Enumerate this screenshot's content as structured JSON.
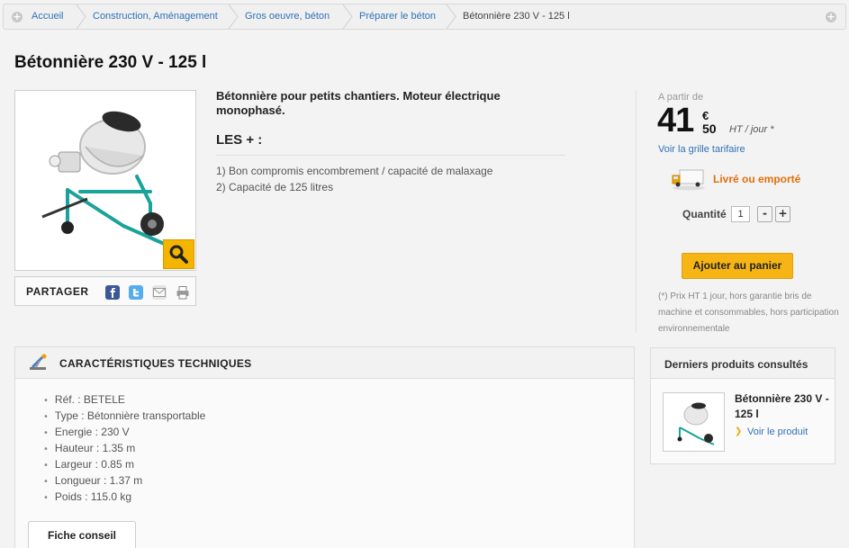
{
  "breadcrumb": {
    "items": [
      "Accueil",
      "Construction, Aménagement",
      "Gros oeuvre, béton",
      "Préparer le béton",
      "Bétonnière 230 V - 125 l"
    ],
    "plus_glyph": "+"
  },
  "product": {
    "title": "Bétonnière 230 V - 125 l",
    "description": "Bétonnière pour petits chantiers. Moteur électrique monophasé.",
    "plus_title": "LES + :",
    "plus_items": [
      "1) Bon compromis encombrement / capacité de malaxage",
      "2) Capacité de 125 litres"
    ],
    "share_label": "PARTAGER"
  },
  "pricing": {
    "from_label": "A partir de",
    "price_int": "41",
    "currency": "€",
    "price_dec": "50",
    "unit": "HT / jour *",
    "grid_link": "Voir la grille tarifaire",
    "delivery": "Livré ou emporté",
    "qty_label": "Quantité",
    "qty_value": "1",
    "minus": "-",
    "plus": "+",
    "cart_button": "Ajouter au panier",
    "note": "(*) Prix HT 1 jour, hors garantie bris de machine et consommables, hors participation environnementale"
  },
  "tech": {
    "title": "CARACTÉRISTIQUES TECHNIQUES",
    "specs": [
      "Réf. : BETELE",
      "Type : Bétonnière transportable",
      "Energie : 230 V",
      "Hauteur : 1.35 m",
      "Largeur : 0.85 m",
      "Longueur : 1.37 m",
      "Poids : 115.0 kg"
    ],
    "tab": "Fiche conseil"
  },
  "recent": {
    "title": "Derniers produits consultés",
    "product_name": "Bétonnière 230 V - 125 l",
    "link": "Voir le produit"
  },
  "colors": {
    "link": "#2f72b6",
    "accent": "#f6b514",
    "delivery": "#e0700c",
    "machine": "#1aa39a"
  },
  "icons": [
    "plus-circle-icon",
    "magnifier-icon",
    "facebook-icon",
    "twitter-icon",
    "mail-icon",
    "print-icon",
    "truck-icon",
    "tools-icon",
    "arrow-icon"
  ]
}
